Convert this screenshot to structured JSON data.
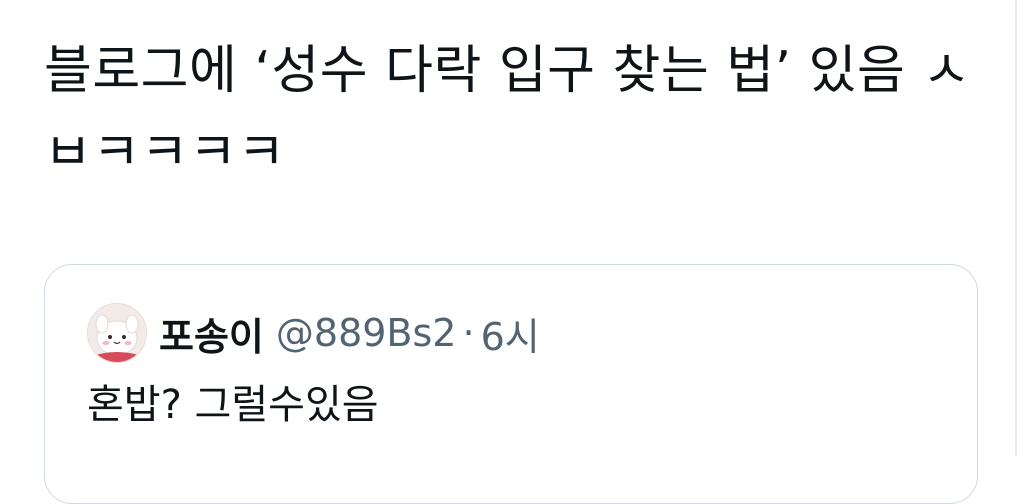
{
  "tweet": {
    "text": "블로그에 ‘성수 다락 입구 찾는 법’ 있음 ㅅㅂㅋㅋㅋㅋ"
  },
  "quoted_tweet": {
    "author_name": "포송이",
    "author_handle": "@889Bs2",
    "separator": "·",
    "timestamp": "6시",
    "text": "혼밥? 그럴수있음"
  },
  "colors": {
    "text_primary": "#0f1419",
    "text_secondary": "#536471",
    "card_border": "#cfd9de",
    "background": "#ffffff"
  }
}
